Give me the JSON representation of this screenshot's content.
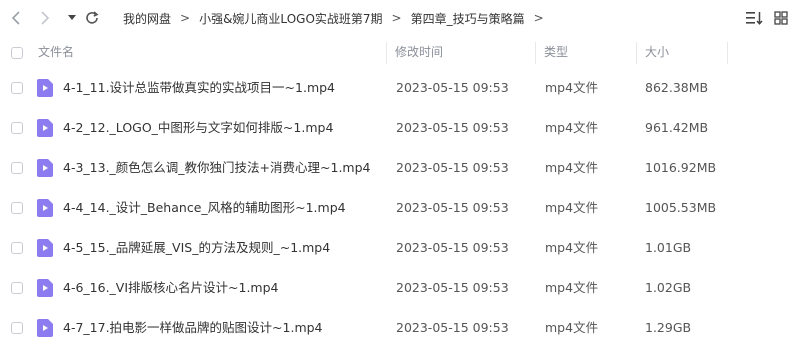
{
  "toolbar": {
    "back_icon": "chevron-left-icon",
    "forward_icon": "chevron-right-icon",
    "history_icon": "caret-down-icon",
    "refresh_icon": "refresh-icon",
    "breadcrumb": [
      "我的网盘",
      "小强&婉儿商业LOGO实战班第7期",
      "第四章_技巧与策略篇"
    ],
    "sort_icon": "sort-list-icon",
    "grid_icon": "grid-view-icon"
  },
  "columns": {
    "name": "文件名",
    "time": "修改时间",
    "type": "类型",
    "size": "大小"
  },
  "files": [
    {
      "name": "4-1_11.设计总监带做真实的实战项目一~1.mp4",
      "time": "2023-05-15 09:53",
      "type": "mp4文件",
      "size": "862.38MB"
    },
    {
      "name": "4-2_12._LOGO_中图形与文字如何排版~1.mp4",
      "time": "2023-05-15 09:53",
      "type": "mp4文件",
      "size": "961.42MB"
    },
    {
      "name": "4-3_13._颜色怎么调_教你独门技法+消费心理~1.mp4",
      "time": "2023-05-15 09:53",
      "type": "mp4文件",
      "size": "1016.92MB"
    },
    {
      "name": "4-4_14._设计_Behance_风格的辅助图形~1.mp4",
      "time": "2023-05-15 09:53",
      "type": "mp4文件",
      "size": "1005.53MB"
    },
    {
      "name": "4-5_15._品牌延展_VIS_的方法及规则_~1.mp4",
      "time": "2023-05-15 09:53",
      "type": "mp4文件",
      "size": "1.01GB"
    },
    {
      "name": "4-6_16._VI排版核心名片设计~1.mp4",
      "time": "2023-05-15 09:53",
      "type": "mp4文件",
      "size": "1.02GB"
    },
    {
      "name": "4-7_17.拍电影一样做品牌的贴图设计~1.mp4",
      "time": "2023-05-15 09:53",
      "type": "mp4文件",
      "size": "1.29GB"
    }
  ],
  "file_icon": "video-file-icon",
  "colors": {
    "file_icon": "#8b7cf0",
    "muted": "#9aa0a6",
    "header_text": "#8a8f99"
  }
}
